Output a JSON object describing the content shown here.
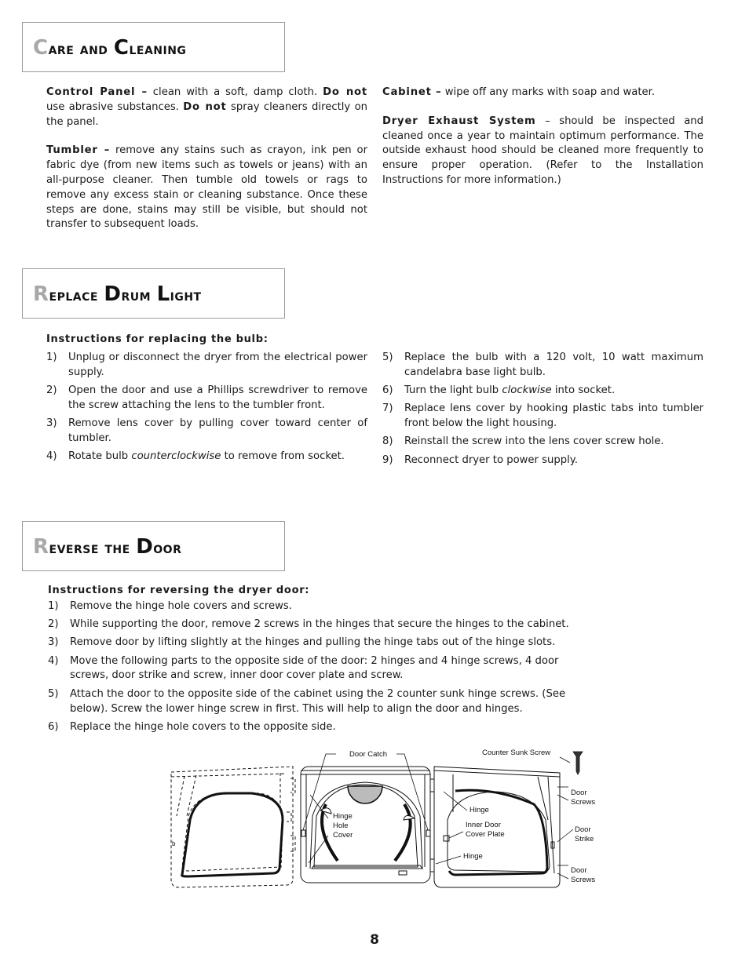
{
  "sections": {
    "care": {
      "title_first": "C",
      "title_rest1": "are and ",
      "title_second": "C",
      "title_rest2": "leaning",
      "left": [
        {
          "label": "Control Panel –",
          "text_a": " clean with a soft, damp cloth. ",
          "bold_a": "Do not",
          "text_b": " use abrasive substances. ",
          "bold_b": "Do not",
          "text_c": " spray cleaners directly on the panel."
        },
        {
          "label": "Tumbler –",
          "text": " remove any stains such as crayon, ink pen or fabric dye (from new items such as towels or jeans) with an all-purpose cleaner.  Then tumble old towels or rags to remove any excess stain or cleaning substance. Once these steps are done, stains may still be visible, but should not transfer to subsequent loads."
        }
      ],
      "right": [
        {
          "label": "Cabinet –",
          "text": " wipe off any marks with soap and water."
        },
        {
          "label": "Dryer Exhaust System",
          "text": " – should be inspected and cleaned once a year to maintain optimum performance. The outside exhaust hood should be cleaned more frequently to ensure proper operation. (Refer to the Installation Instructions for more information.)"
        }
      ]
    },
    "drum_light": {
      "title_first": "R",
      "title_rest1": "eplace ",
      "title_second": "D",
      "title_rest2": "rum ",
      "title_third": "L",
      "title_rest3": "ight",
      "subheading": "Instructions for replacing the bulb:",
      "steps_left": [
        {
          "num": "1)",
          "text": "Unplug or disconnect the dryer from the electrical power supply."
        },
        {
          "num": "2)",
          "text": "Open the door and use a Phillips screwdriver to remove the screw attaching the lens to the tumbler front."
        },
        {
          "num": "3)",
          "text": "Remove lens cover by pulling cover toward center of tumbler."
        },
        {
          "num": "4)",
          "pre": "Rotate bulb ",
          "em": "counterclockwise",
          "post": " to remove from socket."
        }
      ],
      "steps_right": [
        {
          "num": "5)",
          "text": "Replace the bulb with a 120 volt, 10 watt maximum candelabra base light bulb."
        },
        {
          "num": "6)",
          "pre": "Turn the light bulb ",
          "em": "clockwise",
          "post": " into socket."
        },
        {
          "num": "7)",
          "text": "Replace lens cover by hooking plastic tabs into tumbler front below the light housing."
        },
        {
          "num": "8)",
          "text": "Reinstall the screw into the lens cover screw hole."
        },
        {
          "num": "9)",
          "text": "Reconnect dryer to power supply."
        }
      ]
    },
    "reverse_door": {
      "title_first": "R",
      "title_rest1": "everse the ",
      "title_second": "D",
      "title_rest2": "oor",
      "subheading": "Instructions for reversing the dryer door:",
      "steps": [
        {
          "num": "1)",
          "text": "Remove the hinge hole covers and screws."
        },
        {
          "num": "2)",
          "text": "While supporting the door, remove 2 screws in the hinges that secure the hinges to the cabinet."
        },
        {
          "num": "3)",
          "text": "Remove door by lifting slightly at the hinges and pulling the hinge tabs out of the hinge slots."
        },
        {
          "num": "4)",
          "text": "Move the following parts to the opposite side of the door: 2 hinges and 4 hinge screws, 4 door screws, door strike and screw, inner door cover plate and screw."
        },
        {
          "num": "5)",
          "text": "Attach the door to the opposite side of the cabinet using the 2 counter sunk hinge screws. (See below). Screw the lower hinge screw in first. This will help to align the door and hinges."
        },
        {
          "num": "6)",
          "text": "Replace the hinge hole covers to the opposite side."
        }
      ],
      "diagram_labels": {
        "door_catch": "Door Catch",
        "hinge_hole_cover": [
          "Hinge",
          "Hole",
          "Cover"
        ],
        "counter_sunk_screw": "Counter Sunk Screw",
        "hinge_top": "Hinge",
        "inner_door_cover_plate": [
          "Inner Door",
          "Cover Plate"
        ],
        "hinge_bottom": "Hinge",
        "door_screws_top": [
          "Door",
          "Screws"
        ],
        "door_strike": [
          "Door",
          "Strike"
        ],
        "door_screws_bottom": [
          "Door",
          "Screws"
        ]
      }
    }
  },
  "page_number": "8"
}
